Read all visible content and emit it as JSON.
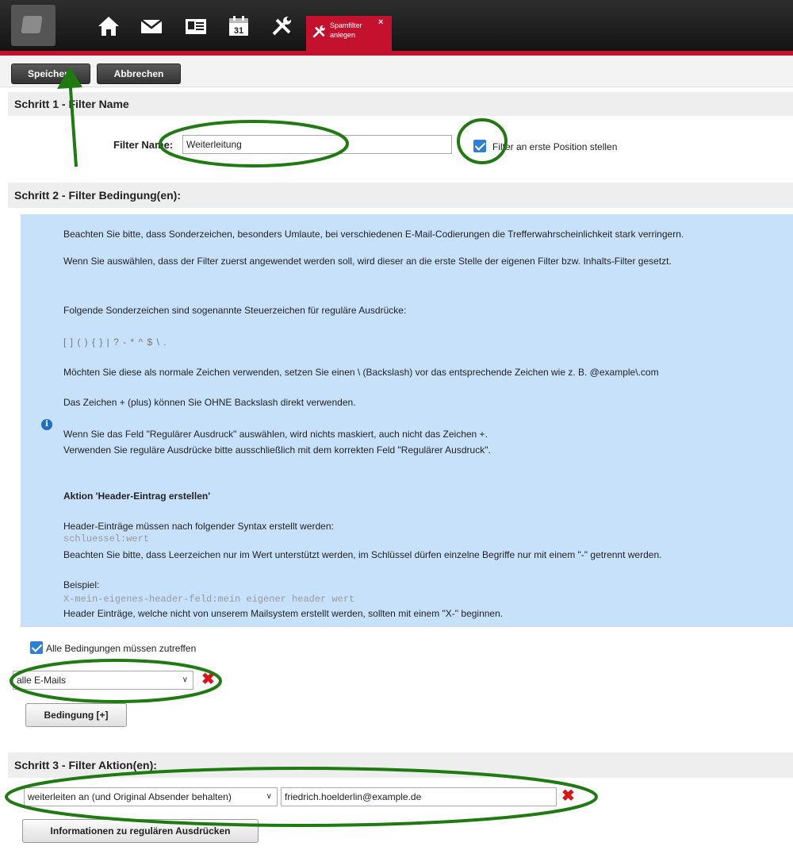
{
  "topbar": {
    "icons": [
      "home-icon",
      "mail-icon",
      "contacts-icon",
      "calendar-icon",
      "tools-icon"
    ],
    "active_tab": {
      "icon": "tools-icon",
      "label_line1": "Spamfilter",
      "label_line2": "anlegen",
      "close": "×"
    }
  },
  "toolbar": {
    "save_label": "Speichern",
    "cancel_label": "Abbrechen"
  },
  "step1": {
    "title": "Schritt 1 - Filter Name",
    "filter_name_label": "Filter Name:",
    "filter_name_value": "Weiterleitung",
    "first_position_label": "Filter an erste Position stellen",
    "first_position_checked": true
  },
  "step2": {
    "title": "Schritt 2 - Filter Bedingung(en):",
    "info": {
      "line1": "Beachten Sie bitte, dass Sonderzeichen, besonders Umlaute, bei verschiedenen E-Mail-Codierungen die Trefferwahrscheinlichkeit stark verringern.",
      "line2": "Wenn Sie auswählen, dass der Filter zuerst angewendet werden soll, wird dieser an die erste Stelle der eigenen Filter bzw. Inhalts-Filter gesetzt.",
      "line3": "Folgende Sonderzeichen sind sogenannte Steuerzeichen für reguläre Ausdrücke:",
      "line4": "[ ] ( ) { } | ? - * ^ $ \\ .",
      "line5": "Möchten Sie diese als normale Zeichen verwenden, setzen Sie einen \\ (Backslash) vor das entsprechende Zeichen wie z. B. @example\\.com",
      "line6": "Das Zeichen + (plus) können Sie OHNE Backslash direkt verwenden.",
      "line7": "Wenn Sie das Feld \"Regulärer Ausdruck\" auswählen, wird nichts maskiert, auch nicht das Zeichen +.",
      "line8": "Verwenden Sie reguläre Ausdrücke bitte ausschließlich mit dem korrekten Feld \"Regulärer Ausdruck\".",
      "heading": "Aktion 'Header-Eintrag erstellen'",
      "line9": "Header-Einträge müssen nach folgender Syntax erstellt werden:",
      "code1": "schluessel:wert",
      "line10": "Beachten Sie bitte, dass Leerzeichen nur im Wert unterstützt werden, im Schlüssel dürfen einzelne Begriffe nur mit einem \"-\" getrennt werden.",
      "line11": "Beispiel:",
      "code2": "X-mein-eigenes-header-feld:mein eigener header wert",
      "line12": "Header Einträge, welche nicht von unserem Mailsystem erstellt werden, sollten mit einem \"X-\" beginnen."
    },
    "all_conditions_label": "Alle Bedingungen müssen zutreffen",
    "all_conditions_checked": true,
    "condition_select": "alle E-Mails",
    "add_condition_label": "Bedingung [+]"
  },
  "step3": {
    "title": "Schritt 3 - Filter Aktion(en):",
    "action_select": "weiterleiten an (und Original Absender behalten)",
    "action_value": "friedrich.hoelderlin@example.de",
    "regex_info_label": "Informationen zu regulären Ausdrücken"
  },
  "colors": {
    "accent_red": "#c4112e",
    "info_bg": "#c8e1fb",
    "annotation_green": "#1f7a12"
  }
}
